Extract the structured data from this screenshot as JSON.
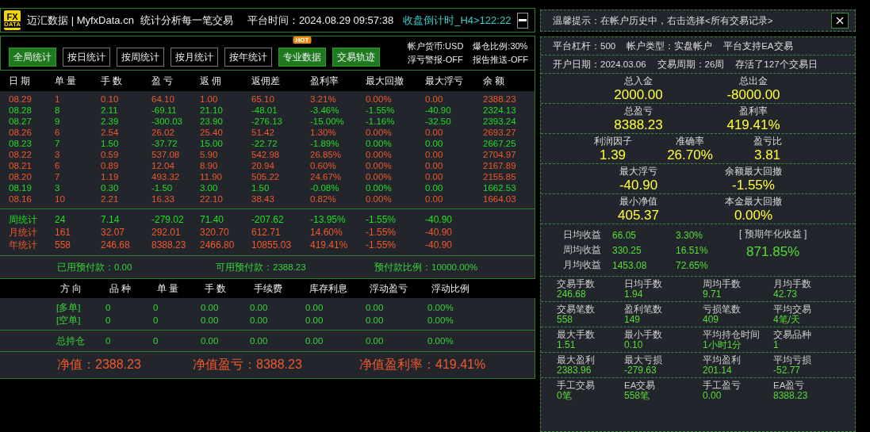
{
  "header": {
    "logo_top": "FX",
    "logo_bottom": "DATA",
    "title": "迈汇数据 | MyfxData.cn",
    "slogan": "统计分析每一笔交易",
    "time": "平台时间：2024.08.29 09:57:38",
    "countdown": "收盘倒计时_H4>122:22"
  },
  "toolbar": {
    "buttons": [
      {
        "label": "全局统计",
        "highlighted": true
      },
      {
        "label": "按日统计",
        "highlighted": false
      },
      {
        "label": "按周统计",
        "highlighted": false
      },
      {
        "label": "按月统计",
        "highlighted": false
      },
      {
        "label": "按年统计",
        "highlighted": false
      },
      {
        "label": "专业数据",
        "highlighted": true,
        "badge": "HOT"
      },
      {
        "label": "交易轨迹",
        "highlighted": true
      }
    ],
    "info": [
      "帐户货币:USD",
      "爆仓比例:30%",
      "浮亏警报-OFF",
      "报告推送-OFF"
    ]
  },
  "table": {
    "columns": [
      "日 期",
      "单 量",
      "手 数",
      "盈 亏",
      "返 佣",
      "返佣差",
      "盈利率",
      "最大回撤",
      "最大浮亏",
      "余 额"
    ],
    "rows": [
      {
        "kind": "gain",
        "cells": [
          "08.29",
          "1",
          "0.10",
          "64.10",
          "1.00",
          "65.10",
          "3.21%",
          "0.00%",
          "0.00",
          "2388.23"
        ]
      },
      {
        "kind": "loss",
        "cells": [
          "08.28",
          "8",
          "2.11",
          "-69.11",
          "21.10",
          "-48.01",
          "-3.46%",
          "-1.55%",
          "-40.90",
          "2324.13"
        ]
      },
      {
        "kind": "loss",
        "cells": [
          "08.27",
          "9",
          "2.39",
          "-300.03",
          "23.90",
          "-276.13",
          "-15.00%",
          "-1.16%",
          "-32.50",
          "2393.24"
        ]
      },
      {
        "kind": "gain",
        "cells": [
          "08.26",
          "6",
          "2.54",
          "26.02",
          "25.40",
          "51.42",
          "1.30%",
          "0.00%",
          "0.00",
          "2693.27"
        ]
      },
      {
        "kind": "loss",
        "cells": [
          "08.23",
          "7",
          "1.50",
          "-37.72",
          "15.00",
          "-22.72",
          "-1.89%",
          "0.00%",
          "0.00",
          "2667.25"
        ]
      },
      {
        "kind": "gain",
        "cells": [
          "08.22",
          "3",
          "0.59",
          "537.08",
          "5.90",
          "542.98",
          "26.85%",
          "0.00%",
          "0.00",
          "2704.97"
        ]
      },
      {
        "kind": "gain",
        "cells": [
          "08.21",
          "6",
          "0.89",
          "12.04",
          "8.90",
          "20.94",
          "0.60%",
          "0.00%",
          "0.00",
          "2167.89"
        ]
      },
      {
        "kind": "gain",
        "cells": [
          "08.20",
          "7",
          "1.19",
          "493.32",
          "11.90",
          "505.22",
          "24.67%",
          "0.00%",
          "0.00",
          "2155.85"
        ]
      },
      {
        "kind": "loss",
        "cells": [
          "08.19",
          "3",
          "0.30",
          "-1.50",
          "3.00",
          "1.50",
          "-0.08%",
          "0.00%",
          "0.00",
          "1662.53"
        ]
      },
      {
        "kind": "gain",
        "cells": [
          "08.16",
          "10",
          "2.21",
          "16.33",
          "22.10",
          "38.43",
          "0.82%",
          "0.00%",
          "0.00",
          "1664.03"
        ]
      }
    ],
    "summary": [
      {
        "kind": "loss",
        "cells": [
          "周统计",
          "24",
          "7.14",
          "-279.02",
          "71.40",
          "-207.62",
          "-13.95%",
          "-1.55%",
          "-40.90"
        ]
      },
      {
        "kind": "gain",
        "cells": [
          "月统计",
          "161",
          "32.07",
          "292.01",
          "320.70",
          "612.71",
          "14.60%",
          "-1.55%",
          "-40.90"
        ]
      },
      {
        "kind": "gain",
        "cells": [
          "年统计",
          "558",
          "246.68",
          "8388.23",
          "2466.80",
          "10855.03",
          "419.41%",
          "-1.55%",
          "-40.90"
        ]
      }
    ]
  },
  "prepaid": [
    "已用预付款：0.00",
    "可用预付款：2388.23",
    "预付款比例：10000.00%"
  ],
  "positions": {
    "columns": [
      "方 向",
      "品 种",
      "单 量",
      "手 数",
      "手续费",
      "库存利息",
      "浮动盈亏",
      "浮动比例"
    ],
    "rows": [
      [
        "[多单]",
        "0",
        "0",
        "0.00",
        "0.00",
        "0.00",
        "0.00",
        "0.00%"
      ],
      [
        "[空单]",
        "0",
        "0",
        "0.00",
        "0.00",
        "0.00",
        "0.00",
        "0.00%"
      ]
    ],
    "total": [
      "总持仓",
      "0",
      "0",
      "0.00",
      "0.00",
      "0.00",
      "0.00",
      "0.00%"
    ]
  },
  "net": [
    "净值：2388.23",
    "净值盈亏：8388.23",
    "净值盈利率：419.41%"
  ],
  "tip": "温馨提示：在帐户历史中，右击选择<所有交易记录>",
  "account_lines": [
    [
      "平台杠杆：500",
      "帐户类型：实盘帐户",
      "平台支持EA交易"
    ],
    [
      "开户日期：2024.03.06",
      "交易周期：26周",
      "存活了127个交易日"
    ]
  ],
  "metrics": [
    [
      {
        "label": "总入金",
        "value": "2000.00"
      },
      {
        "label": "总出金",
        "value": "-8000.00"
      }
    ],
    [
      {
        "label": "总盈亏",
        "value": "8388.23"
      },
      {
        "label": "盈利率",
        "value": "419.41%"
      }
    ],
    [
      {
        "label": "利润因子",
        "value": "1.39"
      },
      {
        "label": "准确率",
        "value": "26.70%"
      },
      {
        "label": "盈亏比",
        "value": "3.81"
      }
    ],
    [
      {
        "label": "最大浮亏",
        "value": "-40.90"
      },
      {
        "label": "余额最大回撤",
        "value": "-1.55%"
      }
    ],
    [
      {
        "label": "最小净值",
        "value": "405.37"
      },
      {
        "label": "本金最大回撤",
        "value": "0.00%"
      }
    ]
  ],
  "averages": {
    "rows": [
      [
        "日均收益",
        "66.05",
        "3.30%"
      ],
      [
        "周均收益",
        "330.25",
        "16.51%"
      ],
      [
        "月均收益",
        "1453.08",
        "72.65%"
      ]
    ],
    "annual_label": "[ 预期年化收益 ]",
    "annual_value": "871.85%"
  },
  "stats": [
    [
      {
        "label": "交易手数",
        "value": "246.68"
      },
      {
        "label": "日均手数",
        "value": "1.94"
      },
      {
        "label": "周均手数",
        "value": "9.71"
      },
      {
        "label": "月均手数",
        "value": "42.73"
      }
    ],
    [
      {
        "label": "交易笔数",
        "value": "558"
      },
      {
        "label": "盈利笔数",
        "value": "149"
      },
      {
        "label": "亏损笔数",
        "value": "409"
      },
      {
        "label": "平均交易",
        "value": "4笔/天"
      }
    ],
    [
      {
        "label": "最大手数",
        "value": "1.51"
      },
      {
        "label": "最小手数",
        "value": "0.10"
      },
      {
        "label": "平均持仓时间",
        "value": "1小时1分"
      },
      {
        "label": "交易品种",
        "value": "1"
      }
    ],
    [
      {
        "label": "最大盈利",
        "value": "2383.96"
      },
      {
        "label": "最大亏损",
        "value": "-279.63"
      },
      {
        "label": "平均盈利",
        "value": "201.14"
      },
      {
        "label": "平均亏损",
        "value": "-52.77"
      }
    ],
    [
      {
        "label": "手工交易",
        "value": "0笔"
      },
      {
        "label": "EA交易",
        "value": "558笔"
      },
      {
        "label": "手工盈亏",
        "value": "0.00"
      },
      {
        "label": "EA盈亏",
        "value": "8388.23"
      }
    ]
  ]
}
